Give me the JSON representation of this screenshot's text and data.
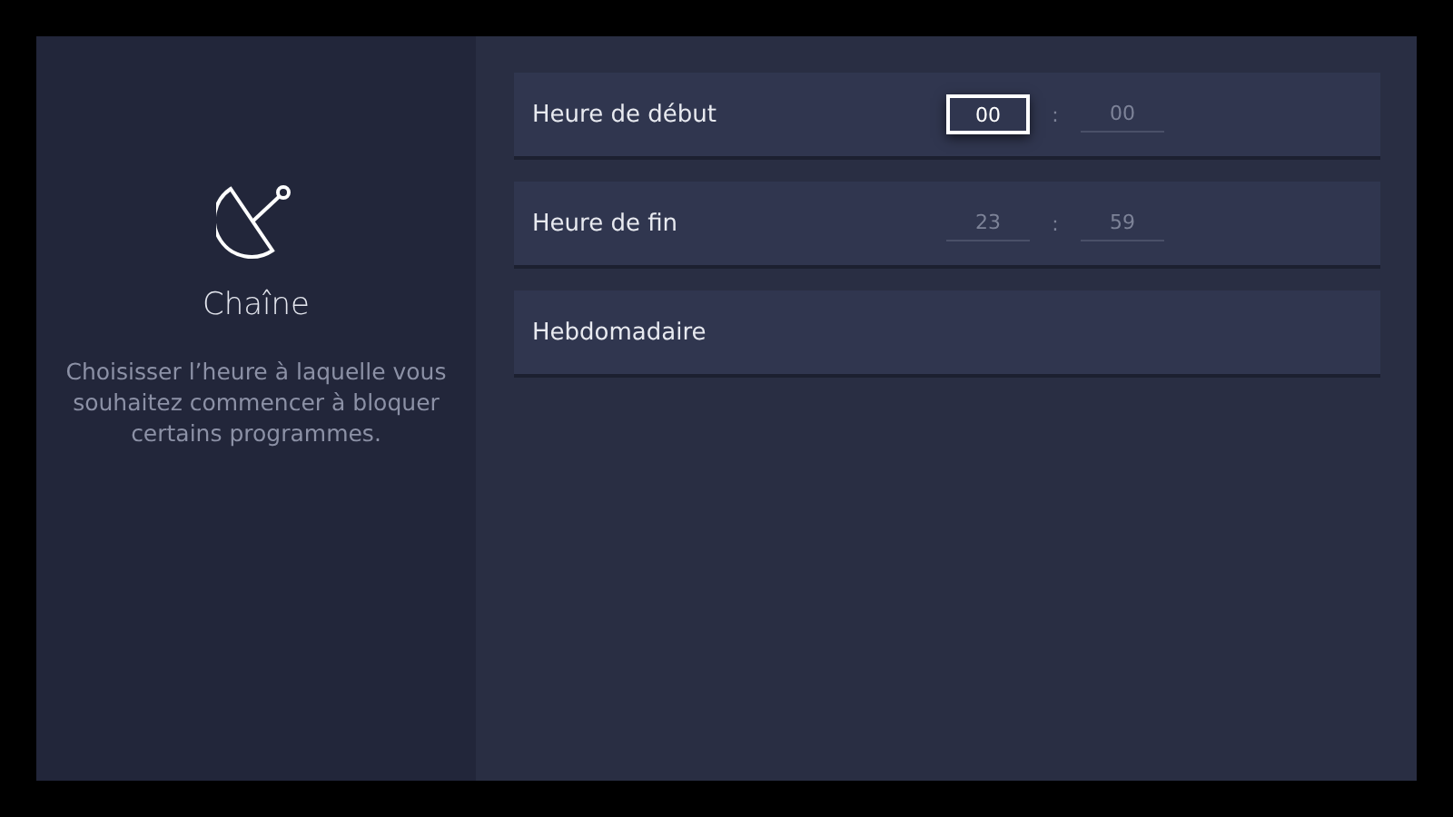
{
  "sidebar": {
    "title": "Chaîne",
    "description": "Choisisser l’heure à laquelle vous souhaitez commencer à bloquer certains programmes."
  },
  "rows": [
    {
      "kind": "time",
      "label": "Heure de début",
      "separator": ":",
      "fields": [
        {
          "value": "00",
          "selected": true
        },
        {
          "value": "00",
          "selected": false
        }
      ]
    },
    {
      "kind": "time",
      "label": "Heure de fin",
      "separator": ":",
      "fields": [
        {
          "value": "23",
          "selected": false
        },
        {
          "value": "59",
          "selected": false
        }
      ]
    },
    {
      "kind": "plain",
      "label": "Hebdomadaire"
    }
  ]
}
